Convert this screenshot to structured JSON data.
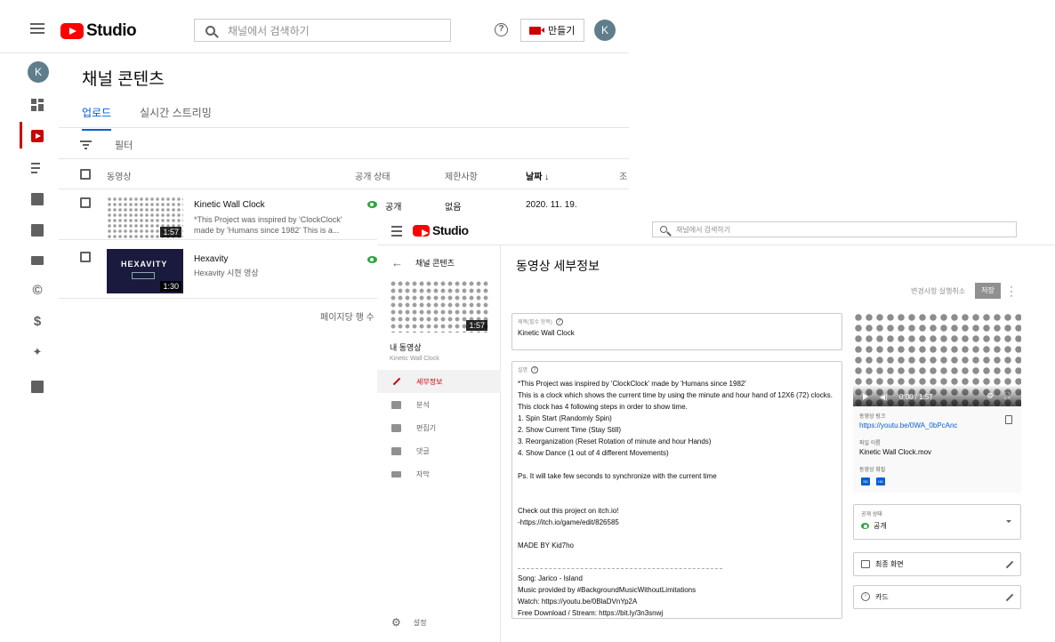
{
  "back": {
    "logo_text": "Studio",
    "search_placeholder": "채널에서 검색하기",
    "create_label": "만들기",
    "avatar_letter": "K",
    "page_title": "채널 콘텐츠",
    "tabs": [
      {
        "label": "업로드",
        "active": true
      },
      {
        "label": "실시간 스트리밍",
        "active": false
      }
    ],
    "filter_label": "필터",
    "columns": {
      "video": "동영상",
      "visibility": "공개 상태",
      "restrictions": "제한사항",
      "date": "날짜 ↓",
      "views": "조"
    },
    "rows": [
      {
        "title": "Kinetic Wall Clock",
        "description": "*This Project was inspired by 'ClockClock' made by 'Humans since 1982' This is a...",
        "duration": "1:57",
        "visibility": "공개",
        "restrictions": "없음",
        "date": "2020. 11. 19."
      },
      {
        "title": "Hexavity",
        "description": "Hexavity 시현 영상",
        "duration": "1:30",
        "thumb_text": "HEXAVITY",
        "visibility": "공개"
      }
    ],
    "rows_per_page": "페이지당 행 수"
  },
  "front": {
    "logo_text": "Studio",
    "search_placeholder": "채널에서 검색하기",
    "back_label": "채널 콘텐츠",
    "your_video": "내 동영상",
    "your_video_sub": "Kinetic Wall Clock",
    "thumb_duration": "1:57",
    "nav": [
      {
        "label": "세부정보",
        "active": true
      },
      {
        "label": "분석",
        "active": false
      },
      {
        "label": "편집기",
        "active": false
      },
      {
        "label": "댓글",
        "active": false
      },
      {
        "label": "자막",
        "active": false
      }
    ],
    "settings_label": "설정",
    "page_title": "동영상 세부정보",
    "undo_label": "변경사항 실행취소",
    "save_label": "저장",
    "title_field_label": "제목(필수 항목)",
    "title_value": "Kinetic Wall Clock",
    "desc_field_label": "설명",
    "description_lines": [
      "*This Project was inspired by 'ClockClock' made by 'Humans since 1982'",
      "This is a clock which shows the current time by using the minute and hour hand of 12X6 (72) clocks.",
      "This clock has 4 following steps in order to show time.",
      "1. Spin Start (Randomly Spin)",
      "2. Show Current Time (Stay Still)",
      "3. Reorganization (Reset Rotation of minute and hour Hands)",
      "4. Show Dance (1 out of 4 different Movements)",
      "",
      "Ps. It will take few seconds to synchronize with the current time",
      "",
      "",
      "Check out this project on itch.io!",
      "-https://itch.io/game/edit/826585",
      "",
      "MADE BY Kid7ho",
      "",
      "---",
      "Song: Jarico - Island",
      "Music provided by #BackgroundMusicWithoutLimitations",
      "Watch: https://youtu.be/0BlaDVnYp2A",
      "Free Download / Stream: https://bit.ly/3n3snwj"
    ],
    "player_time": "0:00 / 1:57",
    "link_label": "동영상 링크",
    "link_value": "https://youtu.be/0WA_0bPcAnc",
    "file_label": "파일 이름",
    "file_value": "Kinetic Wall Clock.mov",
    "quality_label": "동영상 화질",
    "quality_badges": [
      "SD",
      "HD"
    ],
    "visibility_label": "공개 상태",
    "visibility_value": "공개",
    "end_screen_label": "최종 화면",
    "cards_label": "카드"
  },
  "colors": {
    "brand_red": "#ff0000",
    "active_red": "#cc0000",
    "link_blue": "#065fd4",
    "public_green": "#2ba640"
  }
}
